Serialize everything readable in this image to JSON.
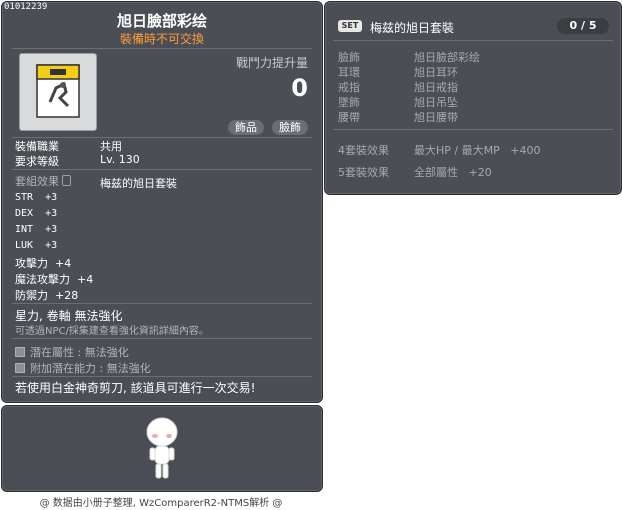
{
  "item": {
    "code": "01012239",
    "name": "旭日臉部彩绘",
    "trade_note": "裝備時不可交換",
    "combat_power_label": "戰鬥力提升量",
    "combat_power_value": "0",
    "tags": [
      "飾品",
      "臉飾"
    ],
    "job_label": "裝備職業",
    "job_value": "共用",
    "level_label": "要求等級",
    "level_value": "Lv. 130",
    "set_effect_label": "套組效果",
    "set_effect_value": "梅兹的旭日套裝",
    "stats": [
      {
        "name": "STR",
        "value": "+3"
      },
      {
        "name": "DEX",
        "value": "+3"
      },
      {
        "name": "INT",
        "value": "+3"
      },
      {
        "name": "LUK",
        "value": "+3"
      },
      {
        "name": "攻擊力",
        "value": "+4"
      },
      {
        "name": "魔法攻擊力",
        "value": "+4"
      },
      {
        "name": "防禦力",
        "value": "+28"
      }
    ],
    "no_enhance": "星力, 卷軸 無法強化",
    "npc_note": "可透過NPC/採集建查看強化資訊詳細內容。",
    "potential_label": "潛在屬性",
    "potential_value": ": 無法強化",
    "additional_label": "附加潛在能力",
    "additional_value": ": 無法強化",
    "scissors_note": "若使用白金神奇剪刀, 該道具可進行一次交易!"
  },
  "set_panel": {
    "badge": "SET",
    "name": "梅兹的旭日套裝",
    "count": "0 / 5",
    "parts": [
      {
        "slot": "臉飾",
        "item": "旭日臉部彩绘"
      },
      {
        "slot": "耳環",
        "item": "旭日耳环"
      },
      {
        "slot": "戒指",
        "item": "旭日戒指"
      },
      {
        "slot": "墜飾",
        "item": "旭日吊坠"
      },
      {
        "slot": "腰帶",
        "item": "旭日腰带"
      }
    ],
    "effects": [
      {
        "label": "4套裝效果",
        "stat": "最大HP / 最大MP",
        "value": "+400"
      },
      {
        "label": "5套裝效果",
        "stat": "全部屬性",
        "value": "+20"
      }
    ]
  },
  "footer": "@ 数据由小册子整理, WzComparerR2-NTMS解析 @",
  "colors": {
    "panel": "#4b4e55",
    "accent_orange": "#ff9e3a",
    "text_gray": "#a9a9a9"
  }
}
